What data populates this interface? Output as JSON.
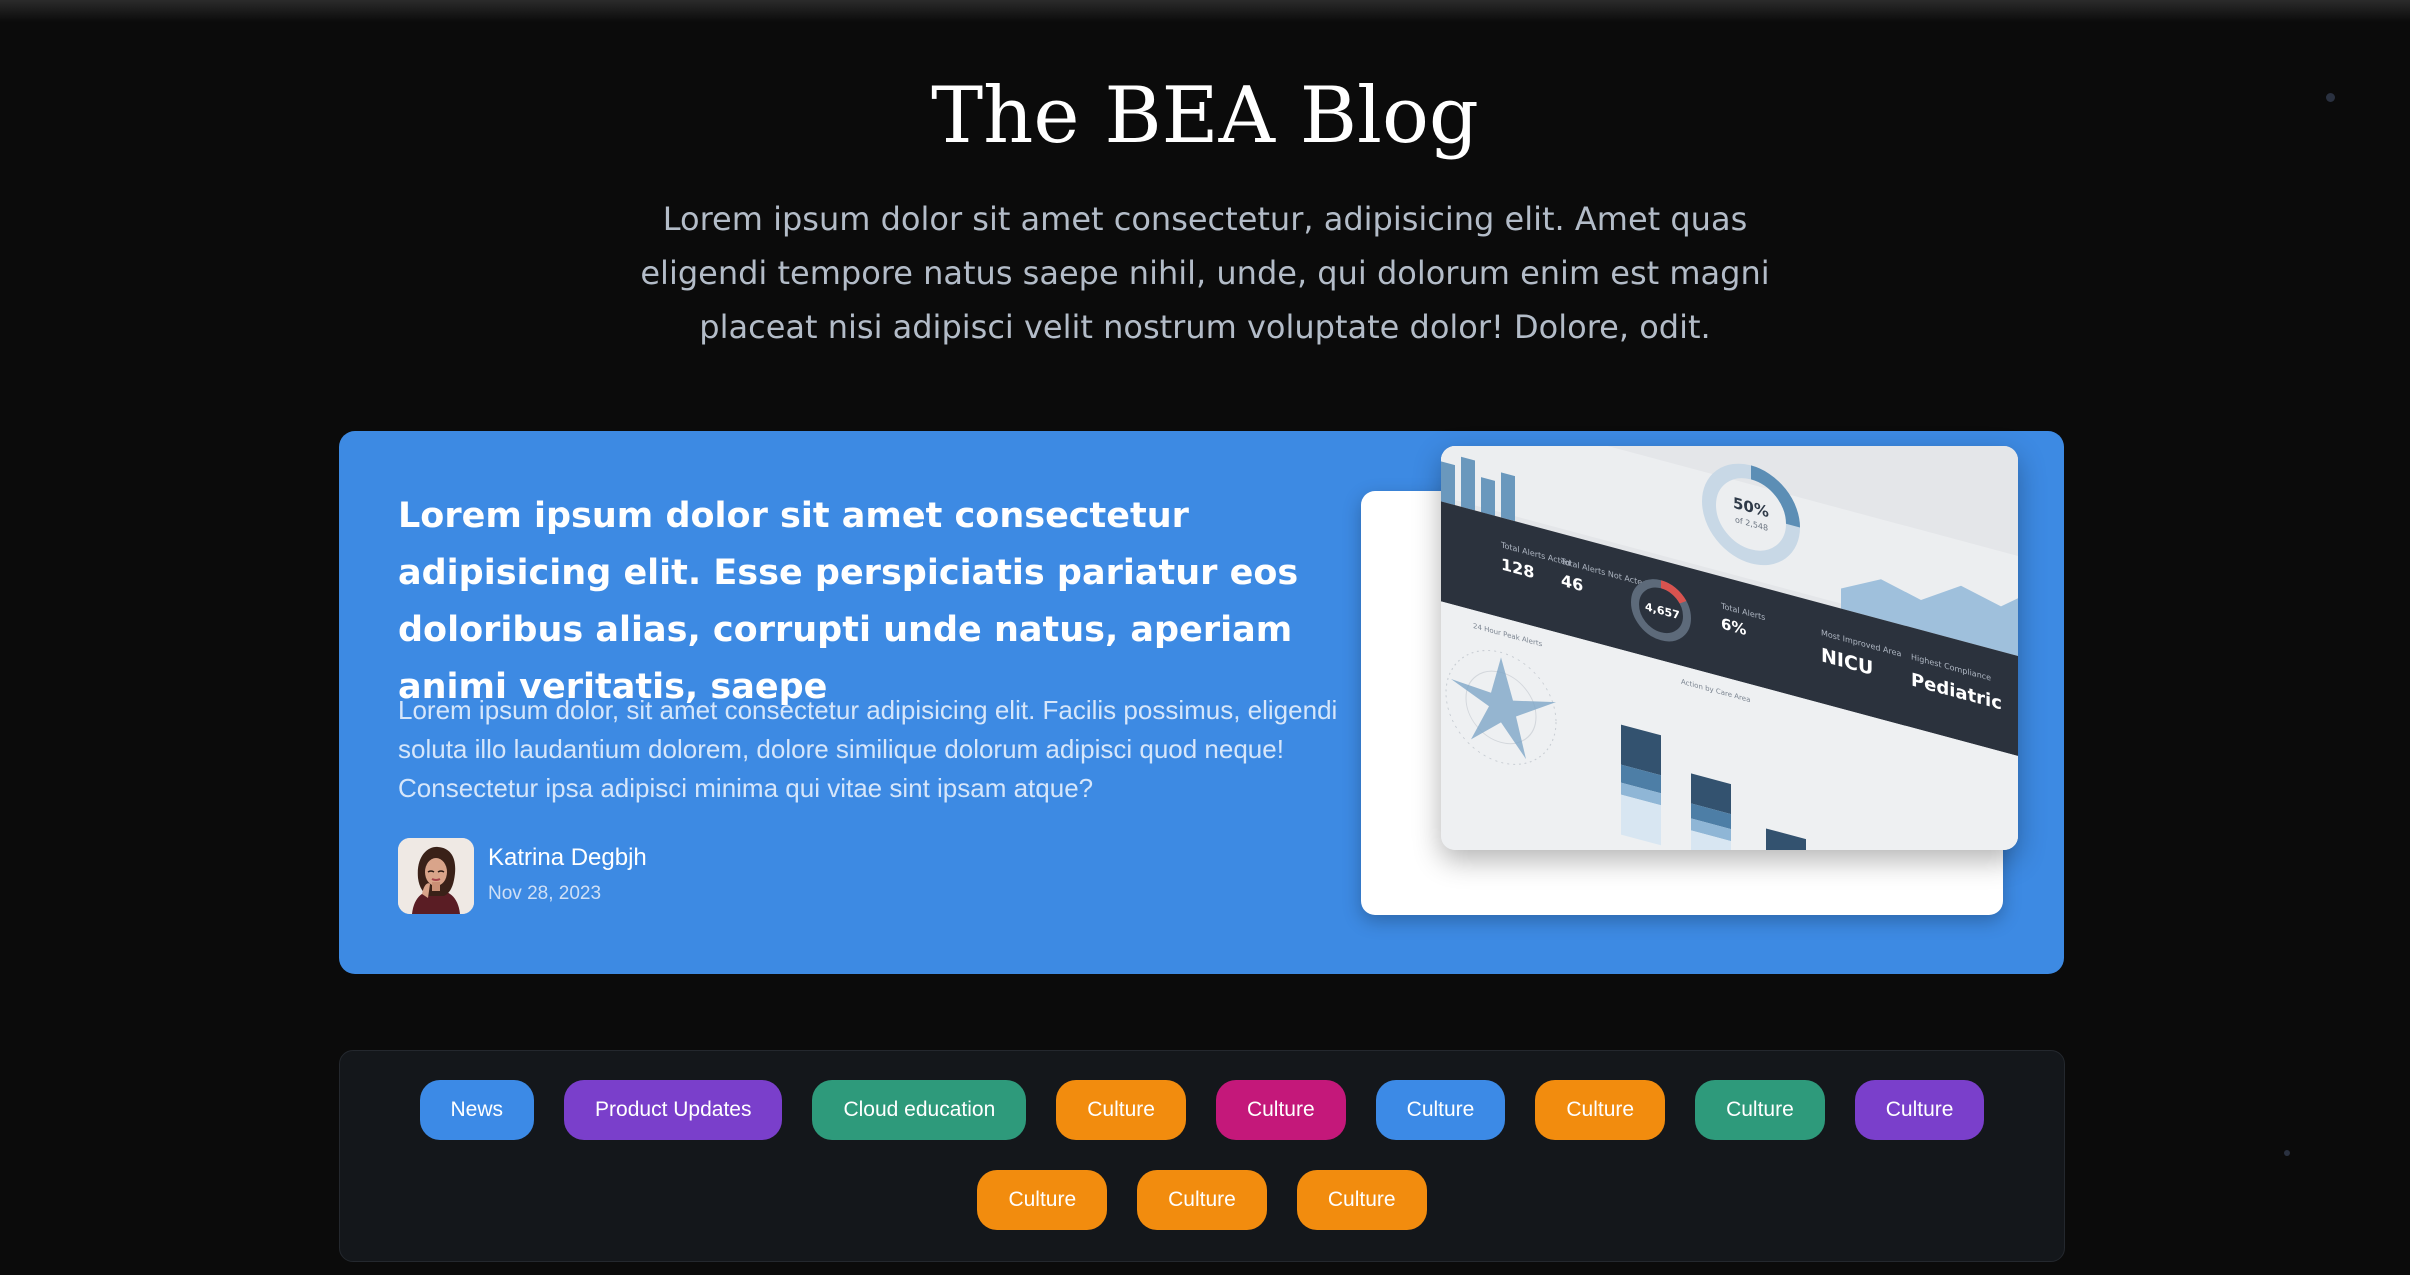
{
  "header": {
    "title": "The BEA Blog",
    "intro": "Lorem ipsum dolor sit amet consectetur, adipisicing elit. Amet quas eligendi tempore natus saepe nihil, unde, qui dolorum enim est magni placeat nisi adipisci velit nostrum voluptate dolor! Dolore, odit."
  },
  "featured": {
    "headline": "Lorem ipsum dolor sit amet consectetur adipisicing elit. Esse perspiciatis pariatur eos doloribus alias, corrupti unde natus, aperiam animi veritatis, saepe",
    "excerpt": "Lorem ipsum dolor, sit amet consectetur adipisicing elit. Facilis possimus, eligendi soluta illo laudantium dolorem, dolore similique dolorum adipisci quod neque! Consectetur ipsa adipisci minima qui vitae sint ipsam atque?",
    "author": "Katrina Degbjh",
    "date": "Nov 28, 2023",
    "card_color": "#3d8ae3",
    "image": {
      "stats": {
        "total_alerts_acted": "128",
        "total_alerts_acted_label": "Total Alerts Acted",
        "total_alerts_not_acted": "46",
        "total_alerts_not_acted_label": "Total Alerts Not Acted",
        "donut_value": "4,657",
        "total_alerts_pct": "6%",
        "total_alerts_label": "Total Alerts",
        "most_improved_label": "Most Improved Area",
        "most_improved_value": "NICU",
        "highest_compliance_label": "Highest Compliance",
        "highest_compliance_value": "Pediatric",
        "top_donut": "50%",
        "top_donut_sub": "of 2,548"
      },
      "chart_heading": "Action by Care Area",
      "radar_heading": "24 Hour Peak Alerts"
    }
  },
  "tags": [
    {
      "label": "News",
      "color": "#3c8ae6"
    },
    {
      "label": "Product Updates",
      "color": "#7a3fcb"
    },
    {
      "label": "Cloud education",
      "color": "#2e9a7b"
    },
    {
      "label": "Culture",
      "color": "#f28c0e"
    },
    {
      "label": "Culture",
      "color": "#c4187a"
    },
    {
      "label": "Culture",
      "color": "#3c8ae6"
    },
    {
      "label": "Culture",
      "color": "#f28c0e"
    },
    {
      "label": "Culture",
      "color": "#2e9a7b"
    },
    {
      "label": "Culture",
      "color": "#7a3fcb"
    },
    {
      "label": "Culture",
      "color": "#f28c0e"
    },
    {
      "label": "Culture",
      "color": "#f28c0e"
    },
    {
      "label": "Culture",
      "color": "#f28c0e"
    }
  ]
}
